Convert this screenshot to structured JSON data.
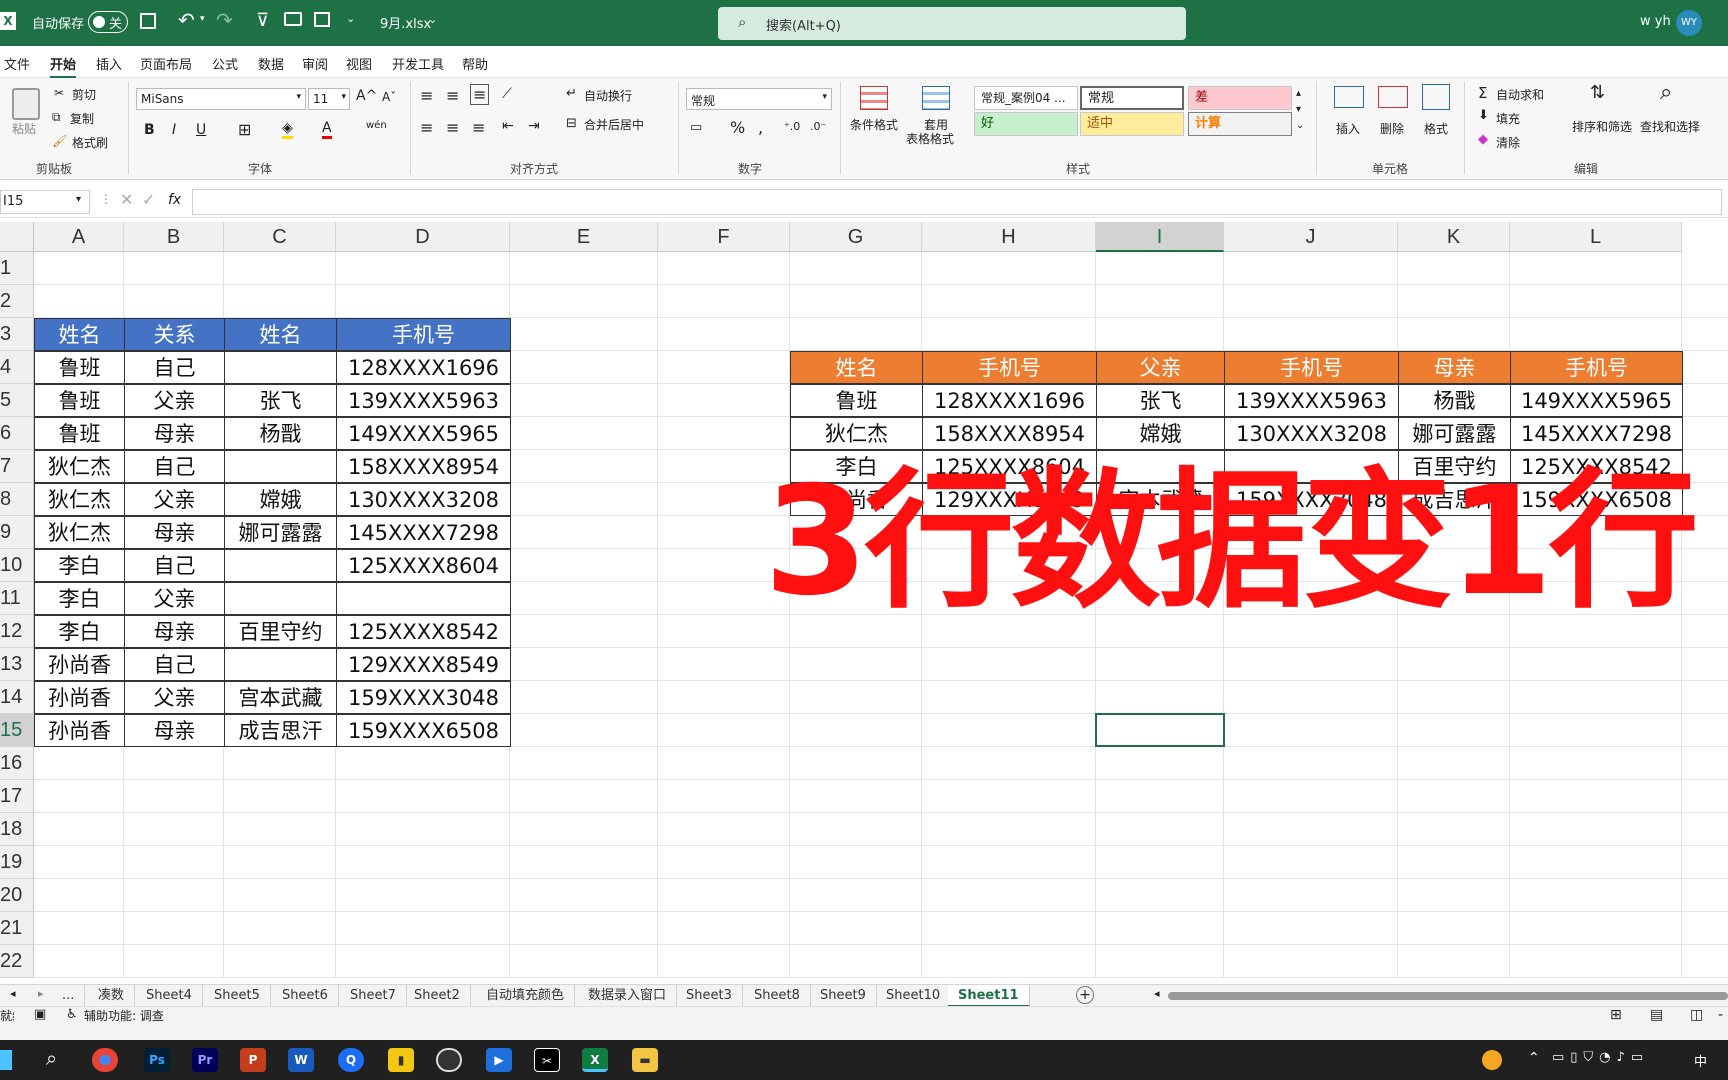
{
  "titlebar": {
    "autosave": "自动保存",
    "toggle": "关",
    "filename": "9月.xlsx",
    "search_placeholder": "搜索(Alt+Q)",
    "user": "w yh",
    "avatar": "WY"
  },
  "menu_tabs": [
    "文件",
    "开始",
    "插入",
    "页面布局",
    "公式",
    "数据",
    "审阅",
    "视图",
    "开发工具",
    "帮助"
  ],
  "ribbon": {
    "clipboard": {
      "paste": "粘贴",
      "cut": "剪切",
      "copy": "复制",
      "format_painter": "格式刷",
      "group": "剪贴板"
    },
    "font": {
      "name": "MiSans",
      "size": "11",
      "group": "字体",
      "bold": "B",
      "italic": "I",
      "underline": "U"
    },
    "align": {
      "wrap": "自动换行",
      "merge": "合并后居中",
      "group": "对齐方式"
    },
    "number": {
      "format": "常规",
      "group": "数字",
      "percent": "%"
    },
    "styles": {
      "cond": "条件格式",
      "table1": "套用",
      "table2": "表格格式",
      "s1": "常规_案例04 ...",
      "s2": "常规",
      "s3": "差",
      "s4": "好",
      "s5": "适中",
      "s6": "计算",
      "group": "样式"
    },
    "cells": {
      "insert": "插入",
      "delete": "删除",
      "format": "格式",
      "group": "单元格"
    },
    "edit": {
      "autosum": "自动求和",
      "fill": "填充",
      "clear": "清除",
      "sort": "排序和筛选",
      "find": "查找和选择",
      "group": "编辑"
    }
  },
  "formula_bar": {
    "namebox": "I15",
    "fx": "fx",
    "value": ""
  },
  "columns": [
    "A",
    "B",
    "C",
    "D",
    "E",
    "F",
    "G",
    "H",
    "I",
    "J",
    "K",
    "L"
  ],
  "rows": [
    "1",
    "2",
    "3",
    "4",
    "5",
    "6",
    "7",
    "8",
    "9",
    "10",
    "11",
    "12",
    "13",
    "14",
    "15",
    "16",
    "17",
    "18",
    "19",
    "20",
    "21",
    "22"
  ],
  "table1": {
    "headers": [
      "姓名",
      "关系",
      "姓名",
      "手机号"
    ],
    "rows": [
      [
        "鲁班",
        "自己",
        "",
        "128XXXX1696"
      ],
      [
        "鲁班",
        "父亲",
        "张飞",
        "139XXXX5963"
      ],
      [
        "鲁班",
        "母亲",
        "杨戬",
        "149XXXX5965"
      ],
      [
        "狄仁杰",
        "自己",
        "",
        "158XXXX8954"
      ],
      [
        "狄仁杰",
        "父亲",
        "嫦娥",
        "130XXXX3208"
      ],
      [
        "狄仁杰",
        "母亲",
        "娜可露露",
        "145XXXX7298"
      ],
      [
        "李白",
        "自己",
        "",
        "125XXXX8604"
      ],
      [
        "李白",
        "父亲",
        "",
        ""
      ],
      [
        "李白",
        "母亲",
        "百里守约",
        "125XXXX8542"
      ],
      [
        "孙尚香",
        "自己",
        "",
        "129XXXX8549"
      ],
      [
        "孙尚香",
        "父亲",
        "宫本武藏",
        "159XXXX3048"
      ],
      [
        "孙尚香",
        "母亲",
        "成吉思汗",
        "159XXXX6508"
      ]
    ]
  },
  "table2": {
    "headers": [
      "姓名",
      "手机号",
      "父亲",
      "手机号",
      "母亲",
      "手机号"
    ],
    "rows": [
      [
        "鲁班",
        "128XXXX1696",
        "张飞",
        "139XXXX5963",
        "杨戬",
        "149XXXX5965"
      ],
      [
        "狄仁杰",
        "158XXXX8954",
        "嫦娥",
        "130XXXX3208",
        "娜可露露",
        "145XXXX7298"
      ],
      [
        "李白",
        "125XXXX8604",
        "",
        "",
        "百里守约",
        "125XXXX8542"
      ],
      [
        "孙尚香",
        "129XXXX8549",
        "宫本武藏",
        "159XXXX3048",
        "成吉思汗",
        "159XXXX6508"
      ]
    ]
  },
  "overlay_title": "3行数据变1行",
  "sheet_tabs": [
    "...",
    "凑数",
    "Sheet4",
    "Sheet5",
    "Sheet6",
    "Sheet7",
    "Sheet2",
    "自动填充颜色",
    "数据录入窗口",
    "Sheet3",
    "Sheet8",
    "Sheet9",
    "Sheet10",
    "Sheet11"
  ],
  "active_sheet": "Sheet11",
  "status": {
    "ready": "就绪",
    "accessibility": "辅助功能: 调查"
  },
  "taskbar": {
    "ime": "中"
  }
}
